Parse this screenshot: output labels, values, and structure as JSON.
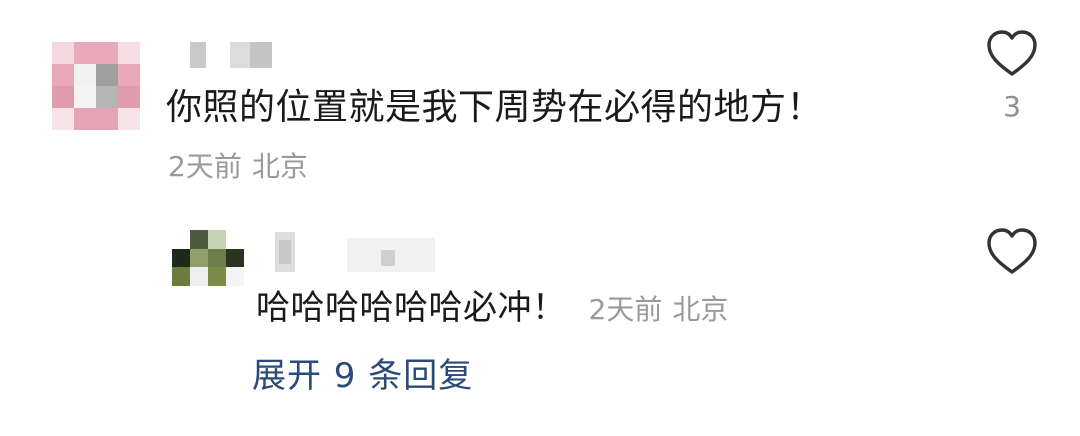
{
  "comment": {
    "text": "你照的位置就是我下周势在必得的地方！",
    "time": "2天前",
    "location": "北京",
    "like_count": "3"
  },
  "reply": {
    "text": "哈哈哈哈哈哈必冲！",
    "time": "2天前",
    "location": "北京"
  },
  "expand_replies": {
    "label": "展开 9 条回复"
  },
  "icons": {
    "like": "heart-outline-icon"
  },
  "colors": {
    "text_primary": "#1a1a1a",
    "text_secondary": "#9a9a9a",
    "link": "#2a4a7a",
    "icon_stroke": "#333333",
    "avatar_main_accent": "#e8a8b8"
  }
}
